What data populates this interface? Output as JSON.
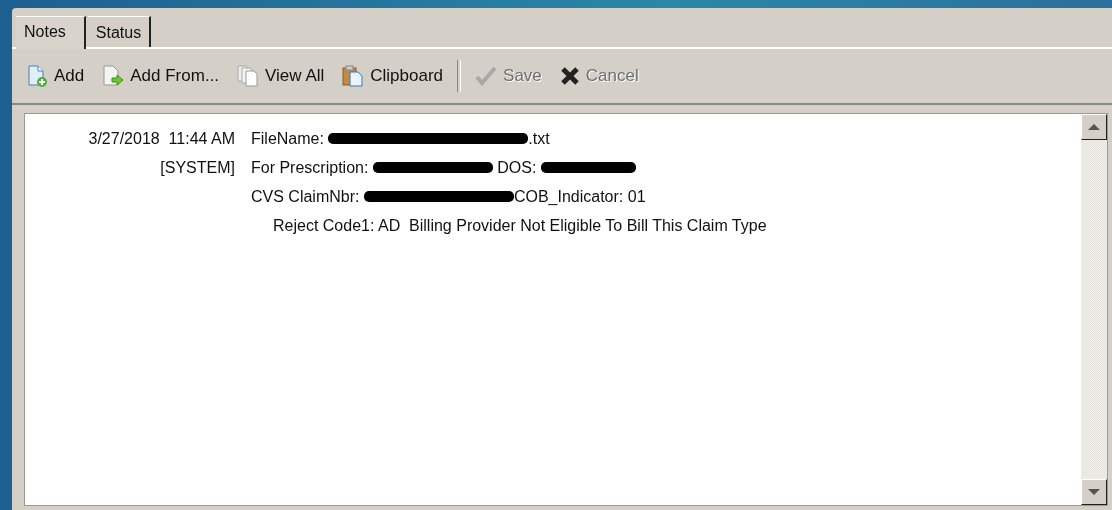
{
  "tabs": [
    {
      "label": "Notes",
      "selected": true
    },
    {
      "label": "Status",
      "selected": false
    }
  ],
  "toolbar": [
    {
      "kind": "button",
      "label": "Add",
      "disabled": false
    },
    {
      "kind": "button",
      "label": "Add From...",
      "disabled": false
    },
    {
      "kind": "button",
      "label": "View All",
      "disabled": false
    },
    {
      "kind": "button",
      "label": "Clipboard",
      "disabled": false
    },
    {
      "kind": "separator"
    },
    {
      "kind": "button",
      "label": "Save",
      "disabled": true
    },
    {
      "kind": "button",
      "label": "Cancel",
      "disabled": true
    }
  ],
  "note": {
    "date": "3/27/2018  11:44 AM",
    "author": "[SYSTEM]",
    "lines": [
      {
        "segments": [
          {
            "kind": "text",
            "text": "FileName: "
          },
          {
            "kind": "redacted"
          },
          {
            "kind": "text",
            "text": ".txt"
          }
        ]
      },
      {
        "segments": [
          {
            "kind": "text",
            "text": "For Prescription: "
          },
          {
            "kind": "redacted"
          },
          {
            "kind": "text",
            "text": " DOS: "
          },
          {
            "kind": "redacted"
          }
        ]
      },
      {
        "segments": [
          {
            "kind": "text",
            "text": "CVS ClaimNbr: "
          },
          {
            "kind": "redacted"
          },
          {
            "kind": "text",
            "text": "COB_Indicator: 01"
          }
        ],
        "children": [
          {
            "segments": [
              {
                "kind": "text",
                "text": "Reject Code1: AD  Billing Provider Not Eligible To Bill This Claim Type"
              }
            ]
          }
        ]
      }
    ]
  }
}
